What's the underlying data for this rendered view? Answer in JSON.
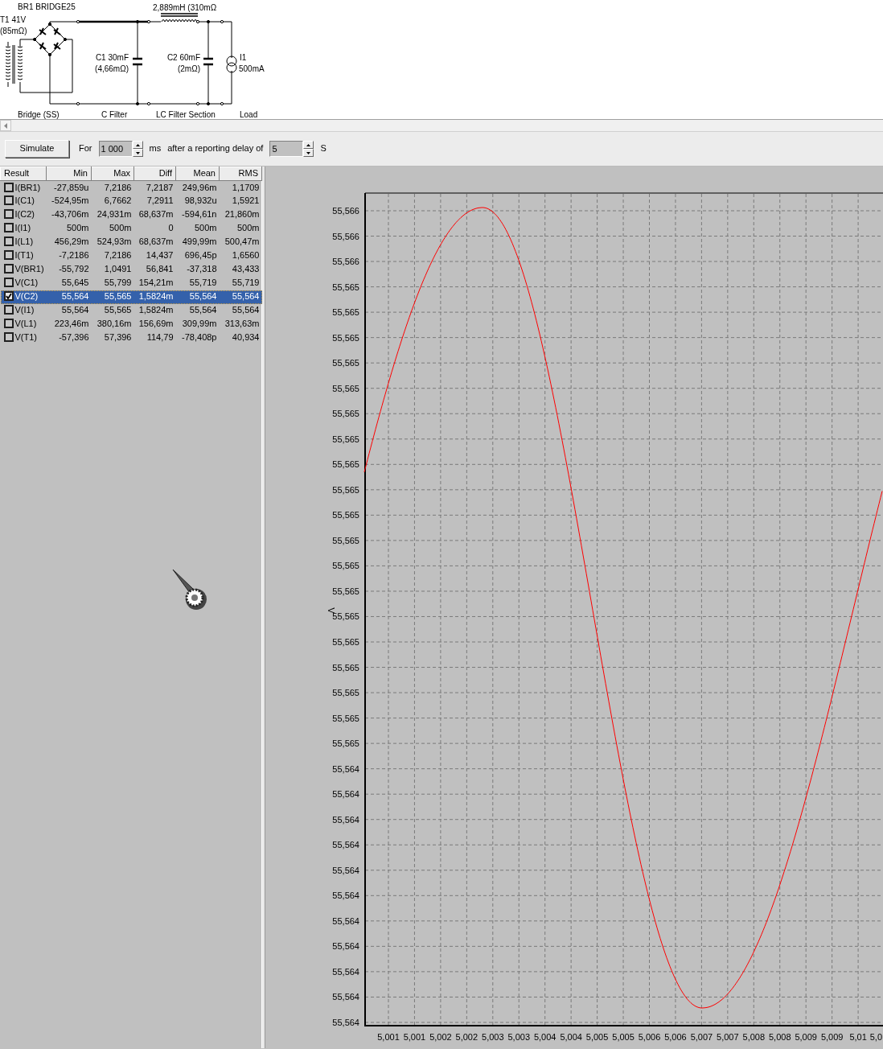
{
  "schematic": {
    "bridge": {
      "name": "BR1 BRIDGE25"
    },
    "transformer": {
      "name": "T1 41V",
      "resistance": "(85mΩ)"
    },
    "inductor": {
      "value": "2,889mH (310mΩ"
    },
    "c1": {
      "name": "C1 30mF",
      "resistance": "(4,66mΩ)"
    },
    "c2": {
      "name": "C2 60mF",
      "resistance": "(2mΩ)"
    },
    "load": {
      "name": "I1",
      "value": "500mA"
    },
    "sections": [
      "Bridge (SS)",
      "C Filter",
      "LC Filter Section",
      "Load"
    ]
  },
  "toolbar": {
    "simulate_button": "Simulate",
    "for_label": "For",
    "duration": "1 000",
    "duration_unit": "ms",
    "delay_label": "after a reporting delay of",
    "delay": "5",
    "delay_unit": "S"
  },
  "results": {
    "columns": [
      "Result",
      "Min",
      "Max",
      "Diff",
      "Mean",
      "RMS"
    ],
    "rows": [
      {
        "name": "I(BR1)",
        "min": "-27,859u",
        "max": "7,2186",
        "diff": "7,2187",
        "mean": "249,96m",
        "rms": "1,1709",
        "checked": false,
        "selected": false
      },
      {
        "name": "I(C1)",
        "min": "-524,95m",
        "max": "6,7662",
        "diff": "7,2911",
        "mean": "98,932u",
        "rms": "1,5921",
        "checked": false,
        "selected": false
      },
      {
        "name": "I(C2)",
        "min": "-43,706m",
        "max": "24,931m",
        "diff": "68,637m",
        "mean": "-594,61n",
        "rms": "21,860m",
        "checked": false,
        "selected": false
      },
      {
        "name": "I(I1)",
        "min": "500m",
        "max": "500m",
        "diff": "0",
        "mean": "500m",
        "rms": "500m",
        "checked": false,
        "selected": false
      },
      {
        "name": "I(L1)",
        "min": "456,29m",
        "max": "524,93m",
        "diff": "68,637m",
        "mean": "499,99m",
        "rms": "500,47m",
        "checked": false,
        "selected": false
      },
      {
        "name": "I(T1)",
        "min": "-7,2186",
        "max": "7,2186",
        "diff": "14,437",
        "mean": "696,45p",
        "rms": "1,6560",
        "checked": false,
        "selected": false
      },
      {
        "name": "V(BR1)",
        "min": "-55,792",
        "max": "1,0491",
        "diff": "56,841",
        "mean": "-37,318",
        "rms": "43,433",
        "checked": false,
        "selected": false
      },
      {
        "name": "V(C1)",
        "min": "55,645",
        "max": "55,799",
        "diff": "154,21m",
        "mean": "55,719",
        "rms": "55,719",
        "checked": false,
        "selected": false
      },
      {
        "name": "V(C2)",
        "min": "55,564",
        "max": "55,565",
        "diff": "1,5824m",
        "mean": "55,564",
        "rms": "55,564",
        "checked": true,
        "selected": true
      },
      {
        "name": "V(I1)",
        "min": "55,564",
        "max": "55,565",
        "diff": "1,5824m",
        "mean": "55,564",
        "rms": "55,564",
        "checked": false,
        "selected": false
      },
      {
        "name": "V(L1)",
        "min": "223,46m",
        "max": "380,16m",
        "diff": "156,69m",
        "mean": "309,99m",
        "rms": "313,63m",
        "checked": false,
        "selected": false
      },
      {
        "name": "V(T1)",
        "min": "-57,396",
        "max": "57,396",
        "diff": "114,79",
        "mean": "-78,408p",
        "rms": "40,934",
        "checked": false,
        "selected": false
      }
    ]
  },
  "plot": {
    "y_label": "V",
    "y_ticks": [
      "55,566",
      "55,566",
      "55,566",
      "55,565",
      "55,565",
      "55,565",
      "55,565",
      "55,565",
      "55,565",
      "55,565",
      "55,565",
      "55,565",
      "55,565",
      "55,565",
      "55,565",
      "55,565",
      "55,565",
      "55,565",
      "55,565",
      "55,565",
      "55,565",
      "55,565",
      "55,564",
      "55,564",
      "55,564",
      "55,564",
      "55,564",
      "55,564",
      "55,564",
      "55,564",
      "55,564",
      "55,564",
      "55,564"
    ],
    "x_ticks": [
      "5,001",
      "5,001",
      "5,002",
      "5,002",
      "5,003",
      "5,003",
      "5,004",
      "5,004",
      "5,005",
      "5,005",
      "5,006",
      "5,006",
      "5,007",
      "5,007",
      "5,008",
      "5,008",
      "5,009",
      "5,009",
      "5,01",
      "5,0"
    ]
  }
}
